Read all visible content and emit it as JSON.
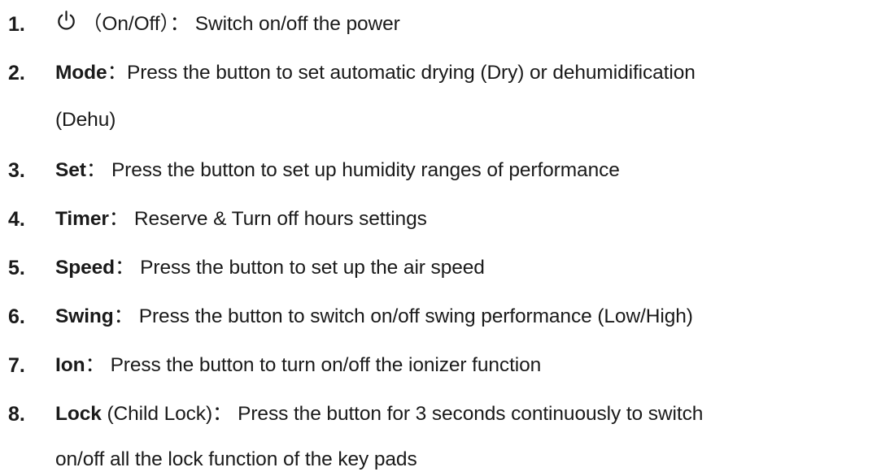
{
  "items": [
    {
      "number": "1.",
      "term": "",
      "icon": "power-icon",
      "paren": "（On/Off）：",
      "text": " Switch on/off the power",
      "cont": ""
    },
    {
      "number": "2.",
      "term": "Mode",
      "paren": "：",
      "text": "Press the button to set automatic drying (Dry) or dehumidification",
      "cont": "(Dehu)"
    },
    {
      "number": "3.",
      "term": "Set",
      "paren": "：",
      "text": " Press the button to set up humidity ranges of performance",
      "cont": ""
    },
    {
      "number": "4.",
      "term": "Timer",
      "paren": "：",
      "text": " Reserve & Turn off hours settings",
      "cont": ""
    },
    {
      "number": "5.",
      "term": "Speed",
      "paren": "：",
      "text": " Press the button to set up the air speed",
      "cont": ""
    },
    {
      "number": "6.",
      "term": "Swing",
      "paren": "：",
      "text": " Press the button to switch on/off swing performance (Low/High)",
      "cont": ""
    },
    {
      "number": "7.",
      "term": "Ion",
      "paren": "：",
      "text": " Press the button to turn on/off the ionizer function",
      "cont": ""
    },
    {
      "number": "8.",
      "term": "Lock",
      "paren": " (Child Lock)：",
      "text": " Press the button for 3 seconds continuously to switch",
      "cont": "on/off all the lock function of the key pads"
    }
  ]
}
